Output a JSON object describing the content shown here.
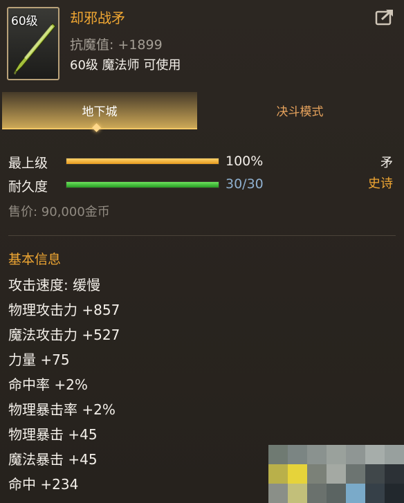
{
  "item": {
    "level_badge": "60级",
    "name": "却邪战矛",
    "magic_resist_label": "抗魔值:",
    "magic_resist_value": "+1899",
    "requirement": "60级 魔法师 可使用"
  },
  "tabs": [
    {
      "label": "地下城",
      "active": true
    },
    {
      "label": "决斗模式",
      "active": false
    }
  ],
  "bars": {
    "level": {
      "label": "最上级",
      "value": "100%",
      "fill": 1.0,
      "color": "#f2b233"
    },
    "durability": {
      "label": "耐久度",
      "value": "30/30",
      "fill": 1.0,
      "color": "#3ec23a"
    }
  },
  "item_type": "矛",
  "rarity": "史诗",
  "sell": "售价: 90,000金币",
  "section_title": "基本信息",
  "attributes": [
    "攻击速度: 缓慢",
    "物理攻击力 +857",
    "魔法攻击力 +527",
    "力量 +75",
    "命中率 +2%",
    "物理暴击率 +2%",
    "物理暴击 +45",
    "魔法暴击 +45",
    "命中 +234"
  ],
  "colors": {
    "name": "#f0a733",
    "rarity": "#f0a733",
    "durability_value": "#8fb0cf",
    "muted": "#a49e95"
  },
  "icons": [
    "spear-icon",
    "share-icon",
    "tab-indicator-icon"
  ]
}
